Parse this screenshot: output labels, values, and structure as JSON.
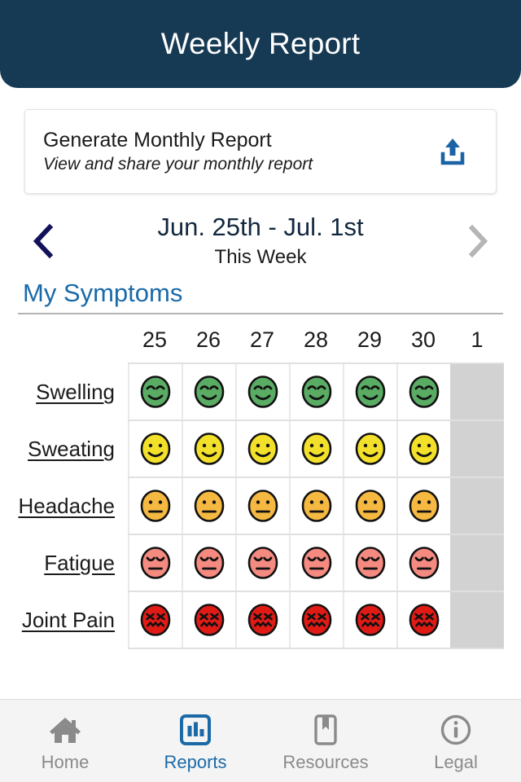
{
  "header": {
    "title": "Weekly Report"
  },
  "generate_card": {
    "title": "Generate Monthly Report",
    "subtitle": "View and share your monthly report",
    "icon": "upload-share-icon"
  },
  "week_nav": {
    "prev_icon": "chevron-left-icon",
    "next_icon": "chevron-right-icon",
    "range": "Jun. 25th - Jul. 1st",
    "label": "This Week"
  },
  "section": {
    "title": "My Symptoms"
  },
  "symptom_grid": {
    "days": [
      "25",
      "26",
      "27",
      "28",
      "29",
      "30",
      "1"
    ],
    "rows": [
      {
        "label": "Swelling",
        "faces": [
          "happy",
          "happy",
          "happy",
          "happy",
          "happy",
          "happy",
          null
        ]
      },
      {
        "label": "Sweating",
        "faces": [
          "smile",
          "smile",
          "smile",
          "smile",
          "smile",
          "smile",
          null
        ]
      },
      {
        "label": "Headache",
        "faces": [
          "neutral",
          "neutral",
          "neutral",
          "neutral",
          "neutral",
          "neutral",
          null
        ]
      },
      {
        "label": "Fatigue",
        "faces": [
          "tired",
          "tired",
          "tired",
          "tired",
          "tired",
          "tired",
          null
        ]
      },
      {
        "label": "Joint Pain",
        "faces": [
          "pain",
          "pain",
          "pain",
          "pain",
          "pain",
          "pain",
          null
        ]
      }
    ],
    "face_colors": {
      "happy": "#5aab63",
      "smile": "#f2e02a",
      "neutral": "#f5b942",
      "tired": "#f48a80",
      "pain": "#e01b16"
    }
  },
  "bottom_nav": {
    "items": [
      {
        "label": "Home",
        "icon": "home-icon",
        "active": false
      },
      {
        "label": "Reports",
        "icon": "bar-chart-icon",
        "active": true
      },
      {
        "label": "Resources",
        "icon": "book-icon",
        "active": false
      },
      {
        "label": "Legal",
        "icon": "info-icon",
        "active": false
      }
    ]
  },
  "colors": {
    "header_bg": "#173A54",
    "accent_blue": "#1a6aa8",
    "nav_inactive": "#8a8a8a",
    "disabled_cell": "#d2d2d2"
  }
}
